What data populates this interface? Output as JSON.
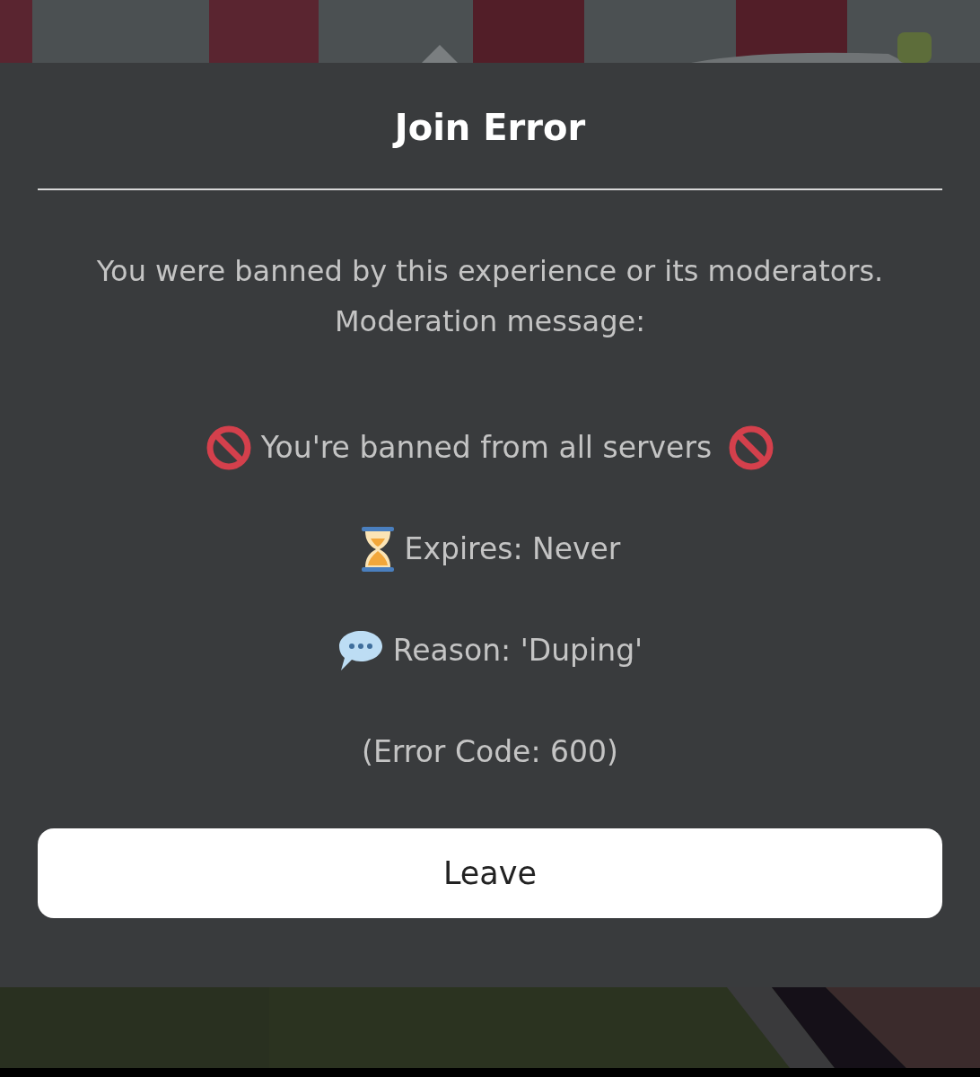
{
  "dialog": {
    "title": "Join Error",
    "description": "You were banned by this experience or its moderators. Moderation message:",
    "message_lines": [
      {
        "kind": "ban",
        "text": "You're banned from all servers"
      },
      {
        "kind": "expiry",
        "text": "Expires: Never"
      },
      {
        "kind": "reason",
        "text": "Reason: 'Duping'"
      },
      {
        "kind": "code",
        "text": "(Error Code: 600)"
      }
    ],
    "buttons": [
      "Leave"
    ]
  }
}
